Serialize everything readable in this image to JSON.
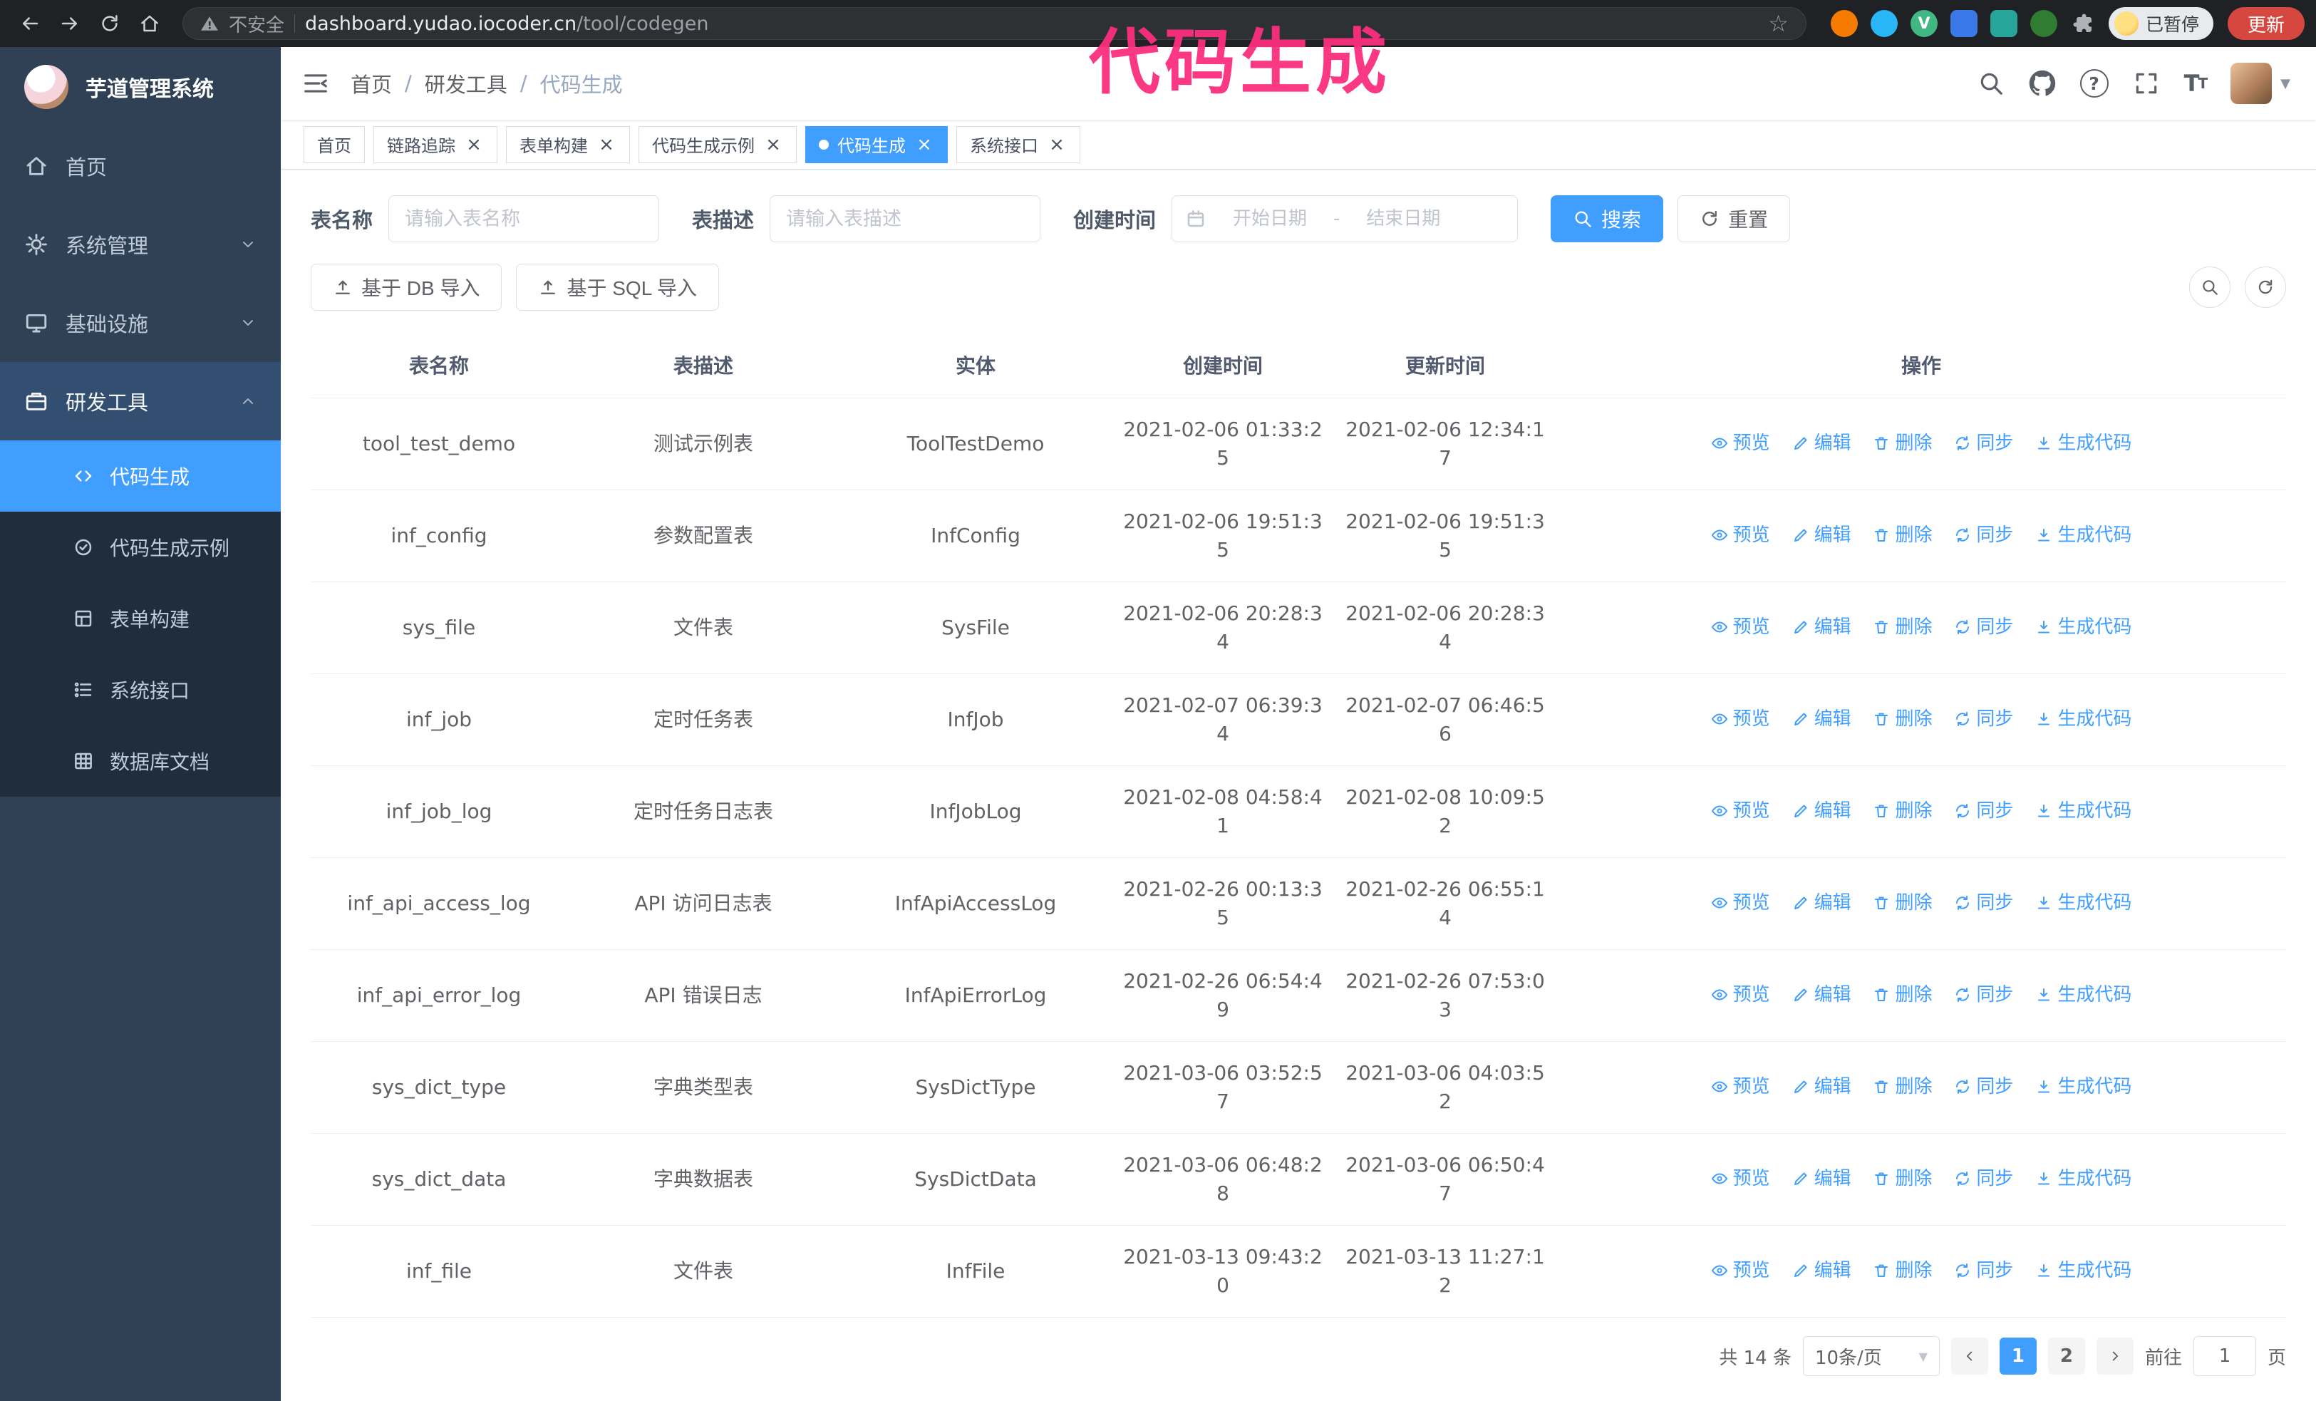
{
  "browser": {
    "security_label": "不安全",
    "url_domain": "dashboard.yudao.iocoder.cn",
    "url_path": "/tool/codegen",
    "paused_badge": "已暂停",
    "update_button": "更新",
    "extension_icons": [
      "flame-extension-icon",
      "drop-extension-icon",
      "vue-devtools-extension-icon",
      "grid-extension-icon",
      "capture-extension-icon",
      "leaf-extension-icon",
      "puzzle-extensions-icon"
    ]
  },
  "icons": {
    "close": "×",
    "star": "☆",
    "caret_down": "▼",
    "vue_letter": "V"
  },
  "annotation": "代码生成",
  "sidebar": {
    "logo_title": "芋道管理系统",
    "menu": [
      {
        "label": "首页"
      },
      {
        "label": "系统管理"
      },
      {
        "label": "基础设施"
      },
      {
        "label": "研发工具"
      }
    ],
    "submenu": [
      {
        "label": "代码生成"
      },
      {
        "label": "代码生成示例"
      },
      {
        "label": "表单构建"
      },
      {
        "label": "系统接口"
      },
      {
        "label": "数据库文档"
      }
    ]
  },
  "breadcrumb": {
    "separator": "/",
    "items": [
      "首页",
      "研发工具",
      "代码生成"
    ]
  },
  "tabs": [
    {
      "label": "首页"
    },
    {
      "label": "链路追踪"
    },
    {
      "label": "表单构建"
    },
    {
      "label": "代码生成示例"
    },
    {
      "label": "代码生成"
    },
    {
      "label": "系统接口"
    }
  ],
  "filters": {
    "table_name_label": "表名称",
    "table_name_placeholder": "请输入表名称",
    "table_desc_label": "表描述",
    "table_desc_placeholder": "请输入表描述",
    "create_time_label": "创建时间",
    "start_date_placeholder": "开始日期",
    "range_separator": "-",
    "end_date_placeholder": "结束日期",
    "search_button": "搜索",
    "reset_button": "重置"
  },
  "toolbar": {
    "import_db": "基于 DB 导入",
    "import_sql": "基于 SQL 导入"
  },
  "table": {
    "columns": [
      "表名称",
      "表描述",
      "实体",
      "创建时间",
      "更新时间",
      "操作"
    ],
    "actions": [
      "预览",
      "编辑",
      "删除",
      "同步",
      "生成代码"
    ],
    "rows": [
      {
        "name": "tool_test_demo",
        "desc": "测试示例表",
        "entity": "ToolTestDemo",
        "created": "2021-02-06 01:33:25",
        "updated": "2021-02-06 12:34:17"
      },
      {
        "name": "inf_config",
        "desc": "参数配置表",
        "entity": "InfConfig",
        "created": "2021-02-06 19:51:35",
        "updated": "2021-02-06 19:51:35"
      },
      {
        "name": "sys_file",
        "desc": "文件表",
        "entity": "SysFile",
        "created": "2021-02-06 20:28:34",
        "updated": "2021-02-06 20:28:34"
      },
      {
        "name": "inf_job",
        "desc": "定时任务表",
        "entity": "InfJob",
        "created": "2021-02-07 06:39:34",
        "updated": "2021-02-07 06:46:56"
      },
      {
        "name": "inf_job_log",
        "desc": "定时任务日志表",
        "entity": "InfJobLog",
        "created": "2021-02-08 04:58:41",
        "updated": "2021-02-08 10:09:52"
      },
      {
        "name": "inf_api_access_log",
        "desc": "API 访问日志表",
        "entity": "InfApiAccessLog",
        "created": "2021-02-26 00:13:35",
        "updated": "2021-02-26 06:55:14"
      },
      {
        "name": "inf_api_error_log",
        "desc": "API 错误日志",
        "entity": "InfApiErrorLog",
        "created": "2021-02-26 06:54:49",
        "updated": "2021-02-26 07:53:03"
      },
      {
        "name": "sys_dict_type",
        "desc": "字典类型表",
        "entity": "SysDictType",
        "created": "2021-03-06 03:52:57",
        "updated": "2021-03-06 04:03:52"
      },
      {
        "name": "sys_dict_data",
        "desc": "字典数据表",
        "entity": "SysDictData",
        "created": "2021-03-06 06:48:28",
        "updated": "2021-03-06 06:50:47"
      },
      {
        "name": "inf_file",
        "desc": "文件表",
        "entity": "InfFile",
        "created": "2021-03-13 09:43:20",
        "updated": "2021-03-13 11:27:12"
      }
    ]
  },
  "pagination": {
    "total": "共 14 条",
    "page_size": "10条/页",
    "pages": [
      "1",
      "2"
    ],
    "goto_label": "前往",
    "goto_value": "1",
    "goto_unit": "页"
  }
}
